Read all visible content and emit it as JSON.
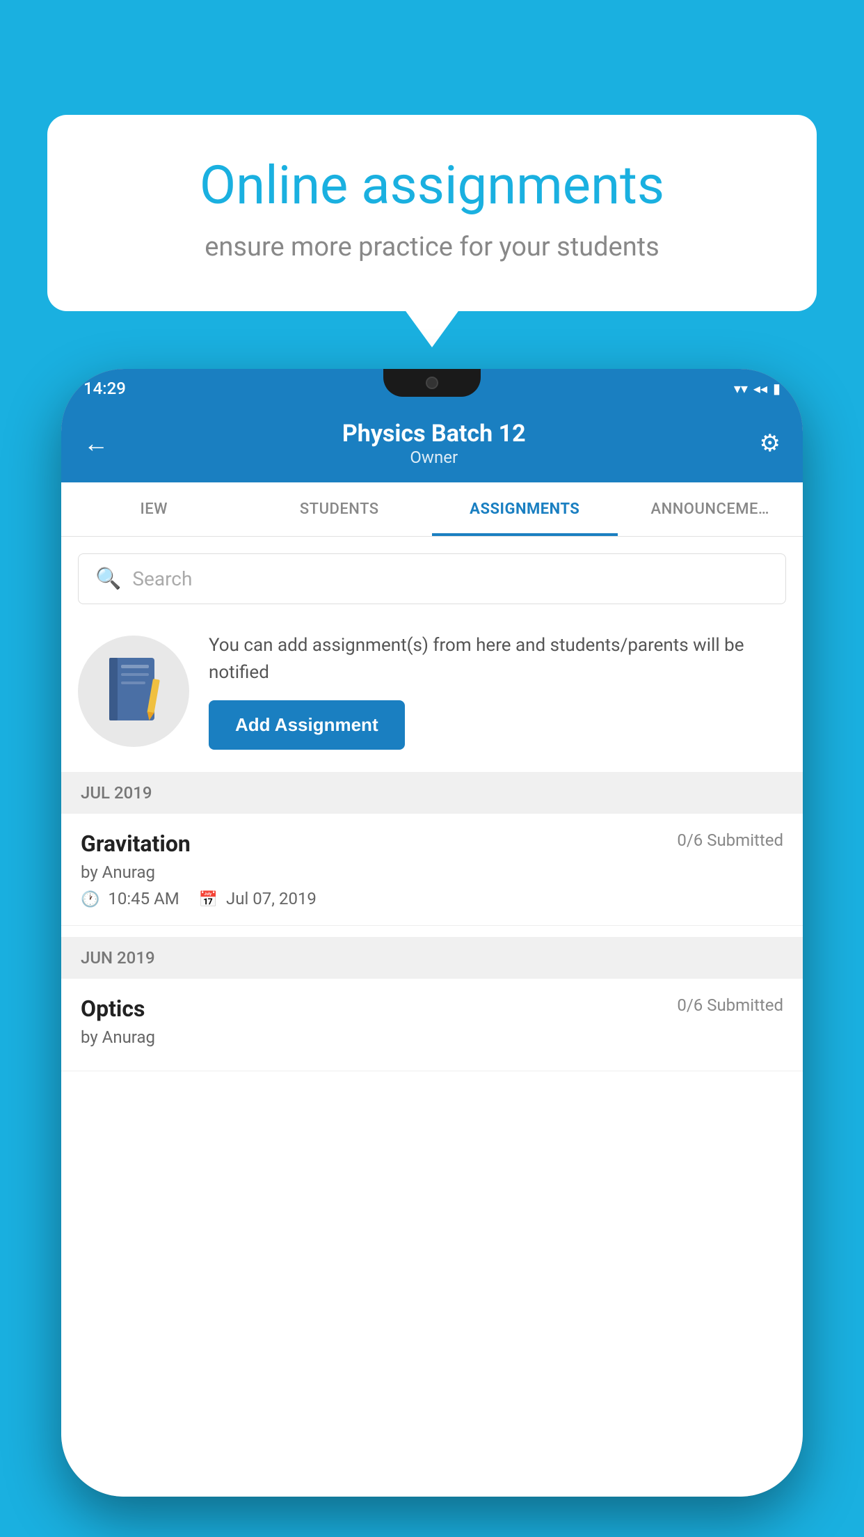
{
  "background": {
    "color": "#1ab0e0"
  },
  "speech_bubble": {
    "title": "Online assignments",
    "subtitle": "ensure more practice for your students"
  },
  "status_bar": {
    "time": "14:29",
    "wifi_icon": "▼",
    "signal_icon": "◀",
    "battery_icon": "▮"
  },
  "header": {
    "back_label": "←",
    "title": "Physics Batch 12",
    "subtitle": "Owner",
    "settings_icon": "⚙"
  },
  "tabs": [
    {
      "label": "IEW",
      "active": false
    },
    {
      "label": "STUDENTS",
      "active": false
    },
    {
      "label": "ASSIGNMENTS",
      "active": true
    },
    {
      "label": "ANNOUNCEMENTS",
      "active": false
    }
  ],
  "search": {
    "placeholder": "Search"
  },
  "info_card": {
    "description": "You can add assignment(s) from here and students/parents will be notified",
    "add_button_label": "Add Assignment"
  },
  "sections": [
    {
      "label": "JUL 2019",
      "items": [
        {
          "name": "Gravitation",
          "submitted": "0/6 Submitted",
          "by": "by Anurag",
          "time": "10:45 AM",
          "date": "Jul 07, 2019"
        }
      ]
    },
    {
      "label": "JUN 2019",
      "items": [
        {
          "name": "Optics",
          "submitted": "0/6 Submitted",
          "by": "by Anurag",
          "time": "",
          "date": ""
        }
      ]
    }
  ]
}
